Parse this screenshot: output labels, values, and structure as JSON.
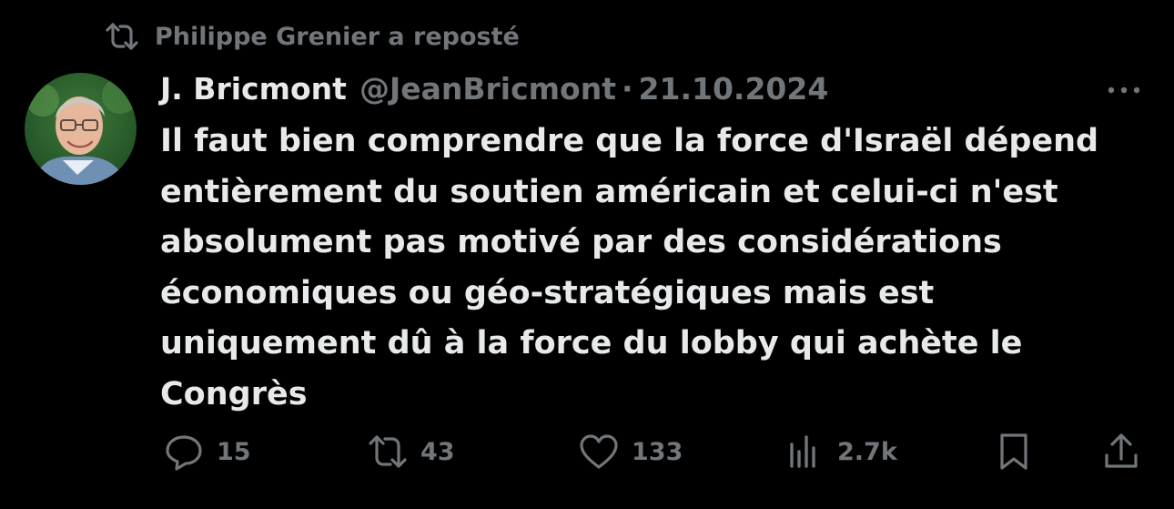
{
  "repost": {
    "label": "Philippe Grenier a reposté",
    "icon": "repost-icon"
  },
  "tweet": {
    "author_name": "J. Bricmont",
    "author_handle": "@JeanBricmont",
    "separator": "·",
    "date": "21.10.2024",
    "text": "Il faut bien comprendre que la force d'Israël dépend\nentièrement du soutien américain et celui-ci n'est\nabsolument pas motivé par des considérations\néconomiques ou géo-stratégiques mais est\nuniquement dû à la force du lobby qui achète le\nCongrès",
    "more_icon": "more-icon"
  },
  "actions": {
    "reply_count": "15",
    "repost_count": "43",
    "like_count": "133",
    "views_count": "2.7k"
  },
  "colors": {
    "background": "#000000",
    "primary_text": "#e7e9ea",
    "secondary_text": "#71767b"
  }
}
